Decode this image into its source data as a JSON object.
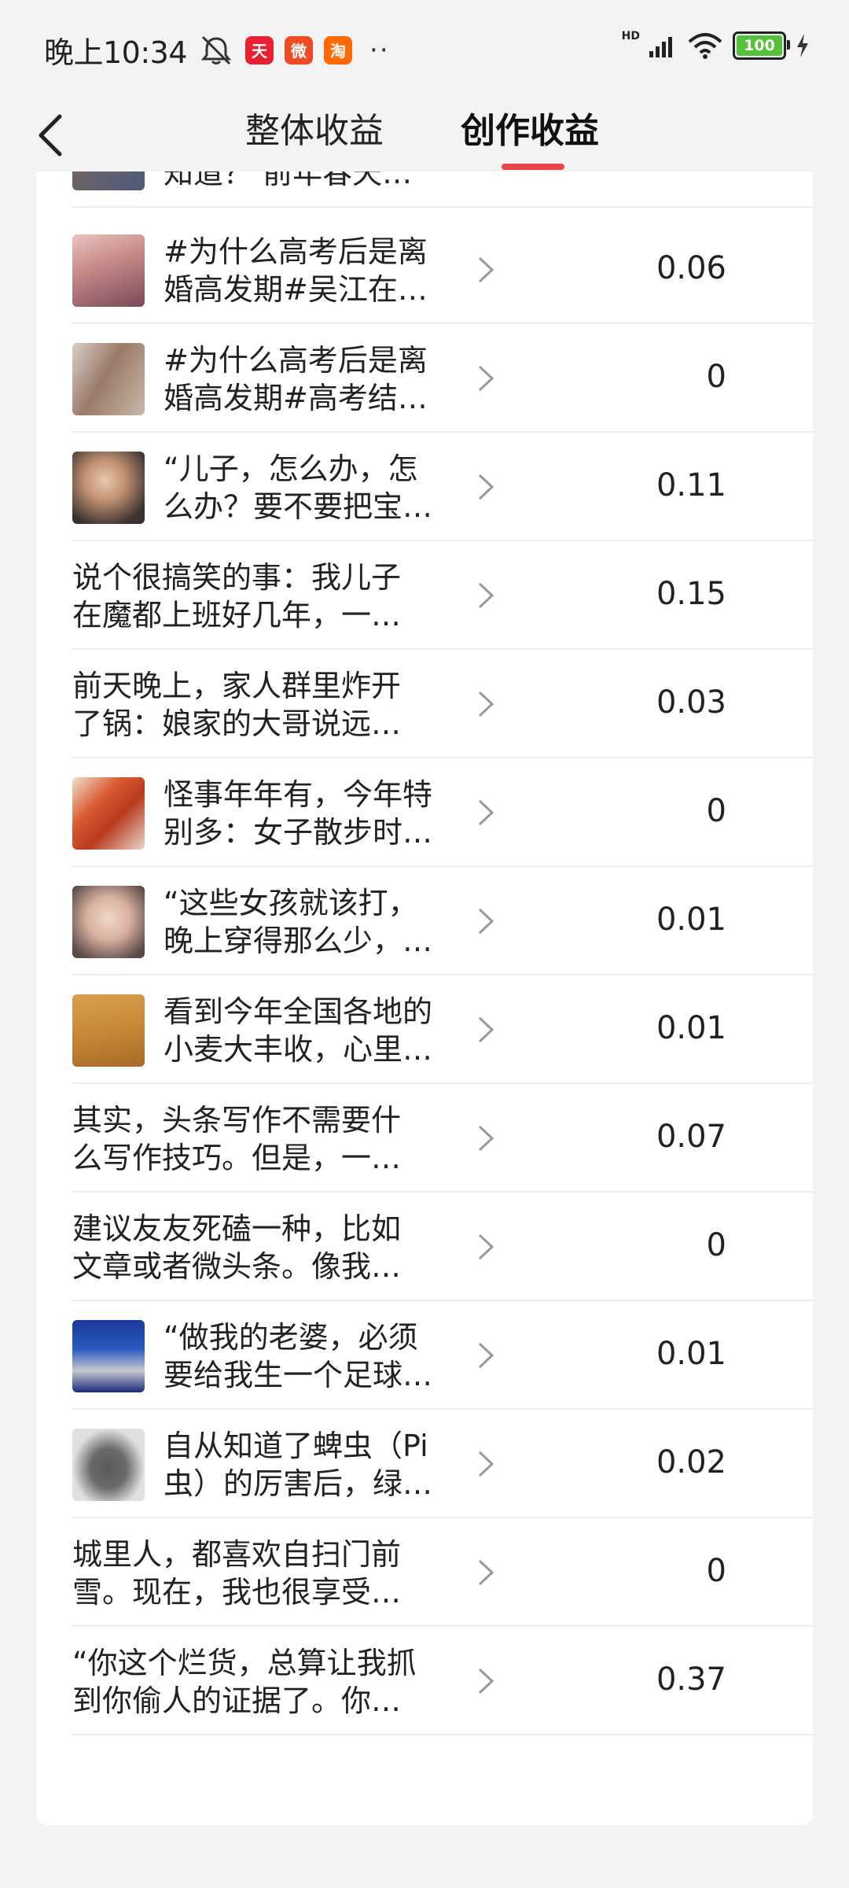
{
  "status_bar": {
    "time": "晚上10:34",
    "app_icons": [
      "tmall-icon",
      "weishi-icon",
      "taobao-icon"
    ],
    "app_icon_text": {
      "tmall": "天",
      "weishi": "微",
      "taobao": "淘"
    },
    "more": "··",
    "network": "HD",
    "battery": "100"
  },
  "header": {
    "tabs": [
      {
        "label": "整体收益",
        "active": false
      },
      {
        "label": "创作收益",
        "active": true
      }
    ],
    "accent_color": "#e9434b"
  },
  "rows": [
    {
      "title_line1": "知道？ 前年春天…",
      "title_line2": "",
      "amount": "",
      "thumb": "photo",
      "partial": true
    },
    {
      "title_line1": "#为什么高考后是离",
      "title_line2": "婚高发期#吴江在…",
      "amount": "0.06",
      "thumb": "photo"
    },
    {
      "title_line1": "#为什么高考后是离",
      "title_line2": "婚高发期#高考结…",
      "amount": "0",
      "thumb": "photo"
    },
    {
      "title_line1": "“儿子，怎么办，怎",
      "title_line2": "么办？要不要把宝…",
      "amount": "0.11",
      "thumb": "photo"
    },
    {
      "title_line1": "说个很搞笑的事：我儿子",
      "title_line2": "在魔都上班好几年，一…",
      "amount": "0.15",
      "thumb": ""
    },
    {
      "title_line1": "前天晚上，家人群里炸开",
      "title_line2": "了锅：娘家的大哥说远…",
      "amount": "0.03",
      "thumb": ""
    },
    {
      "title_line1": "怪事年年有，今年特",
      "title_line2": "别多：女子散步时…",
      "amount": "0",
      "thumb": "photo"
    },
    {
      "title_line1": "“这些女孩就该打，",
      "title_line2": "晚上穿得那么少，…",
      "amount": "0.01",
      "thumb": "photo"
    },
    {
      "title_line1": "看到今年全国各地的",
      "title_line2": "小麦大丰收，心里…",
      "amount": "0.01",
      "thumb": "photo"
    },
    {
      "title_line1": "其实，头条写作不需要什",
      "title_line2": "么写作技巧。但是，一…",
      "amount": "0.07",
      "thumb": ""
    },
    {
      "title_line1": "建议友友死磕一种，比如",
      "title_line2": "文章或者微头条。像我…",
      "amount": "0",
      "thumb": ""
    },
    {
      "title_line1": "“做我的老婆，必须",
      "title_line2": "要给我生一个足球…",
      "amount": "0.01",
      "thumb": "photo"
    },
    {
      "title_line1": "自从知道了蜱虫（Pi",
      "title_line2": "虫）的厉害后，绿…",
      "amount": "0.02",
      "thumb": "photo"
    },
    {
      "title_line1": "城里人，都喜欢自扫门前",
      "title_line2": "雪。现在，我也很享受…",
      "amount": "0",
      "thumb": ""
    },
    {
      "title_line1": "“你这个烂货，总算让我抓",
      "title_line2": "到你偷人的证据了。你…",
      "amount": "0.37",
      "thumb": ""
    }
  ]
}
